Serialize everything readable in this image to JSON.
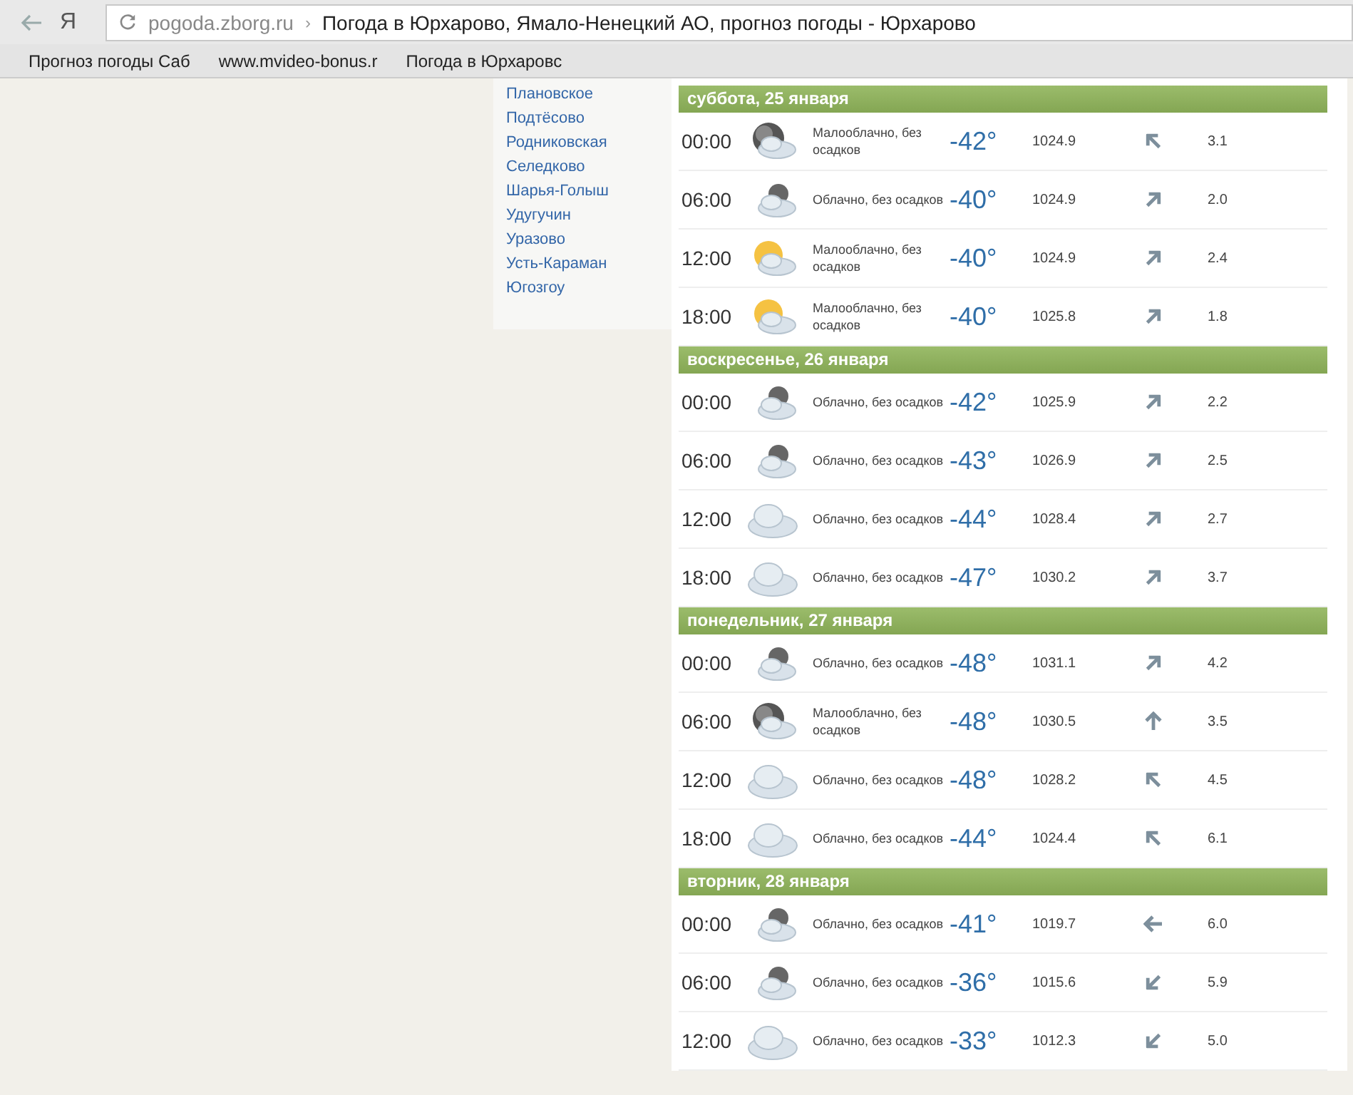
{
  "browser": {
    "logo": "Я",
    "domain": "pogoda.zborg.ru",
    "separator": "›",
    "title": "Погода в Юрхарово, Ямало-Ненецкий АО, прогноз погоды - Юрхарово",
    "bookmarks": [
      "Прогноз погоды Саб",
      "www.mvideo-bonus.r",
      "Погода в Юрхаровс"
    ]
  },
  "sidebar": {
    "items": [
      "Плановское",
      "Подтёсово",
      "Родниковская",
      "Селедково",
      "Шарья-Голыш",
      "Удугучин",
      "Уразово",
      "Усть-Караман",
      "Югозгоу"
    ]
  },
  "days": [
    {
      "title": "суббота, 25 января",
      "rows": [
        {
          "time": "00:00",
          "kind": "moon",
          "desc": "Малооблачно, без осадков",
          "temp": "-42°",
          "pressure": "1024.9",
          "wind": {
            "kind": "nw",
            "speed": "3.1"
          }
        },
        {
          "time": "06:00",
          "kind": "overcast",
          "desc": "Облачно, без осадков",
          "temp": "-40°",
          "pressure": "1024.9",
          "wind": {
            "kind": "ne",
            "speed": "2.0"
          }
        },
        {
          "time": "12:00",
          "kind": "sun",
          "desc": "Малооблачно, без осадков",
          "temp": "-40°",
          "pressure": "1024.9",
          "wind": {
            "kind": "ne",
            "speed": "2.4"
          }
        },
        {
          "time": "18:00",
          "kind": "sun",
          "desc": "Малооблачно, без осадков",
          "temp": "-40°",
          "pressure": "1025.8",
          "wind": {
            "kind": "ne",
            "speed": "1.8"
          }
        }
      ]
    },
    {
      "title": "воскресенье, 26 января",
      "rows": [
        {
          "time": "00:00",
          "kind": "overcast",
          "desc": "Облачно, без осадков",
          "temp": "-42°",
          "pressure": "1025.9",
          "wind": {
            "kind": "ne",
            "speed": "2.2"
          }
        },
        {
          "time": "06:00",
          "kind": "overcast",
          "desc": "Облачно, без осадков",
          "temp": "-43°",
          "pressure": "1026.9",
          "wind": {
            "kind": "ne",
            "speed": "2.5"
          }
        },
        {
          "time": "12:00",
          "kind": "cloud",
          "desc": "Облачно, без осадков",
          "temp": "-44°",
          "pressure": "1028.4",
          "wind": {
            "kind": "ne",
            "speed": "2.7"
          }
        },
        {
          "time": "18:00",
          "kind": "cloud",
          "desc": "Облачно, без осадков",
          "temp": "-47°",
          "pressure": "1030.2",
          "wind": {
            "kind": "ne",
            "speed": "3.7"
          }
        }
      ]
    },
    {
      "title": "понедельник, 27 января",
      "rows": [
        {
          "time": "00:00",
          "kind": "overcast",
          "desc": "Облачно, без осадков",
          "temp": "-48°",
          "pressure": "1031.1",
          "wind": {
            "kind": "ne",
            "speed": "4.2"
          }
        },
        {
          "time": "06:00",
          "kind": "moon",
          "desc": "Малооблачно, без осадков",
          "temp": "-48°",
          "pressure": "1030.5",
          "wind": {
            "kind": "n",
            "speed": "3.5"
          }
        },
        {
          "time": "12:00",
          "kind": "cloud",
          "desc": "Облачно, без осадков",
          "temp": "-48°",
          "pressure": "1028.2",
          "wind": {
            "kind": "nw",
            "speed": "4.5"
          }
        },
        {
          "time": "18:00",
          "kind": "cloud",
          "desc": "Облачно, без осадков",
          "temp": "-44°",
          "pressure": "1024.4",
          "wind": {
            "kind": "nw",
            "speed": "6.1"
          }
        }
      ]
    },
    {
      "title": "вторник, 28 января",
      "rows": [
        {
          "time": "00:00",
          "kind": "overcast",
          "desc": "Облачно, без осадков",
          "temp": "-41°",
          "pressure": "1019.7",
          "wind": {
            "kind": "w",
            "speed": "6.0"
          }
        },
        {
          "time": "06:00",
          "kind": "overcast",
          "desc": "Облачно, без осадков",
          "temp": "-36°",
          "pressure": "1015.6",
          "wind": {
            "kind": "sw",
            "speed": "5.9"
          }
        },
        {
          "time": "12:00",
          "kind": "cloud",
          "desc": "Облачно, без осадков",
          "temp": "-33°",
          "pressure": "1012.3",
          "wind": {
            "kind": "sw",
            "speed": "5.0"
          }
        }
      ]
    }
  ]
}
